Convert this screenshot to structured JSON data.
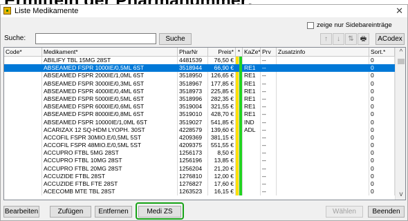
{
  "header": {
    "text": "Ermitteln der Pharmanummer:"
  },
  "window": {
    "title": "Liste Medikamente",
    "close": "✕"
  },
  "options": {
    "sidebar_label": "zeige nur Sidebareinträge"
  },
  "search": {
    "label": "Suche:",
    "value": "",
    "button": "Suche"
  },
  "toolbar": {
    "up": "↑",
    "down": "↓",
    "sort": "⇅",
    "print": "🖶",
    "acodex": "ACodex"
  },
  "columns": [
    "Code*",
    "Medikament*",
    "PharNr",
    "Preis*",
    "*",
    "KaZe*",
    "Prv",
    "Zusatzinfo",
    "Sort.*"
  ],
  "rows": [
    {
      "code": "",
      "med": "ABILIFY TBL 15MG 28ST",
      "pharnr": "4481539",
      "preis": "76,50 €",
      "kaze": "",
      "prv": "--",
      "info": "",
      "sort": "0",
      "selected": false
    },
    {
      "code": "",
      "med": "ABSEAMED FSPR 1000IE/0,5ML 6ST",
      "pharnr": "3518944",
      "preis": "66,90 €",
      "kaze": "RE1",
      "prv": "--",
      "info": "",
      "sort": "0",
      "selected": true
    },
    {
      "code": "",
      "med": "ABSEAMED FSPR 2000IE/1,0ML 6ST",
      "pharnr": "3518950",
      "preis": "126,65 €",
      "kaze": "RE1",
      "prv": "--",
      "info": "",
      "sort": "0",
      "selected": false
    },
    {
      "code": "",
      "med": "ABSEAMED FSPR 3000IE/0,3ML 6ST",
      "pharnr": "3518967",
      "preis": "177,85 €",
      "kaze": "RE1",
      "prv": "--",
      "info": "",
      "sort": "0",
      "selected": false
    },
    {
      "code": "",
      "med": "ABSEAMED FSPR 4000IE/0,4ML 6ST",
      "pharnr": "3518973",
      "preis": "225,85 €",
      "kaze": "RE1",
      "prv": "--",
      "info": "",
      "sort": "0",
      "selected": false
    },
    {
      "code": "",
      "med": "ABSEAMED FSPR 5000IE/0,5ML 6ST",
      "pharnr": "3518996",
      "preis": "282,35 €",
      "kaze": "RE1",
      "prv": "--",
      "info": "",
      "sort": "0",
      "selected": false
    },
    {
      "code": "",
      "med": "ABSEAMED FSPR 6000IE/0,6ML 6ST",
      "pharnr": "3519004",
      "preis": "321,55 €",
      "kaze": "RE1",
      "prv": "--",
      "info": "",
      "sort": "0",
      "selected": false
    },
    {
      "code": "",
      "med": "ABSEAMED FSPR 8000IE/0,8ML 6ST",
      "pharnr": "3519010",
      "preis": "428,70 €",
      "kaze": "RE1",
      "prv": "--",
      "info": "",
      "sort": "0",
      "selected": false
    },
    {
      "code": "",
      "med": "ABSEAMED FSPR 10000IE/1,0ML 6ST",
      "pharnr": "3519027",
      "preis": "541,85 €",
      "kaze": "IND",
      "prv": "--",
      "info": "",
      "sort": "0",
      "selected": false
    },
    {
      "code": "",
      "med": "ACARIZAX 12 SQ-HDM LYOPH. 30ST",
      "pharnr": "4228579",
      "preis": "139,60 €",
      "kaze": "ADL",
      "prv": "--",
      "info": "",
      "sort": "0",
      "selected": false
    },
    {
      "code": "",
      "med": "ACCOFIL FSPR 30MIO.E/0,5ML 5ST",
      "pharnr": "4209369",
      "preis": "381,15 €",
      "kaze": "",
      "prv": "--",
      "info": "",
      "sort": "0",
      "selected": false
    },
    {
      "code": "",
      "med": "ACCOFIL FSPR 48MIO.E/0,5ML 5ST",
      "pharnr": "4209375",
      "preis": "551,55 €",
      "kaze": "",
      "prv": "--",
      "info": "",
      "sort": "0",
      "selected": false
    },
    {
      "code": "",
      "med": "ACCUPRO FTBL 5MG 28ST",
      "pharnr": "1256173",
      "preis": "8,50 €",
      "kaze": "",
      "prv": "--",
      "info": "",
      "sort": "0",
      "selected": false
    },
    {
      "code": "",
      "med": "ACCUPRO FTBL 10MG 28ST",
      "pharnr": "1256196",
      "preis": "13,85 €",
      "kaze": "",
      "prv": "--",
      "info": "",
      "sort": "0",
      "selected": false
    },
    {
      "code": "",
      "med": "ACCUPRO FTBL 20MG 28ST",
      "pharnr": "1256204",
      "preis": "21,20 €",
      "kaze": "",
      "prv": "--",
      "info": "",
      "sort": "0",
      "selected": false
    },
    {
      "code": "",
      "med": "ACCUZIDE FTBL 28ST",
      "pharnr": "1276810",
      "preis": "12,00 €",
      "kaze": "",
      "prv": "--",
      "info": "",
      "sort": "0",
      "selected": false
    },
    {
      "code": "",
      "med": "ACCUZIDE FTBL FTE 28ST",
      "pharnr": "1276827",
      "preis": "17,60 €",
      "kaze": "",
      "prv": "--",
      "info": "",
      "sort": "0",
      "selected": false
    },
    {
      "code": "",
      "med": "ACECOMB MTE TBL 28ST",
      "pharnr": "1263523",
      "preis": "16,15 €",
      "kaze": "",
      "prv": "--",
      "info": "",
      "sort": "0",
      "selected": false
    }
  ],
  "scroll": {
    "up": "^",
    "down": "v"
  },
  "footer": {
    "bearbeiten": "Bearbeiten",
    "zufuegen": "Zufügen",
    "entfernen": "Entfernen",
    "medizs": "Medi ZS",
    "waehlen": "Wählen",
    "beenden": "Beenden"
  },
  "colors": {
    "selection": "#0078d7",
    "marker_yellow": "#ffe000",
    "marker_green": "#22d322",
    "highlight": "#17a317"
  }
}
